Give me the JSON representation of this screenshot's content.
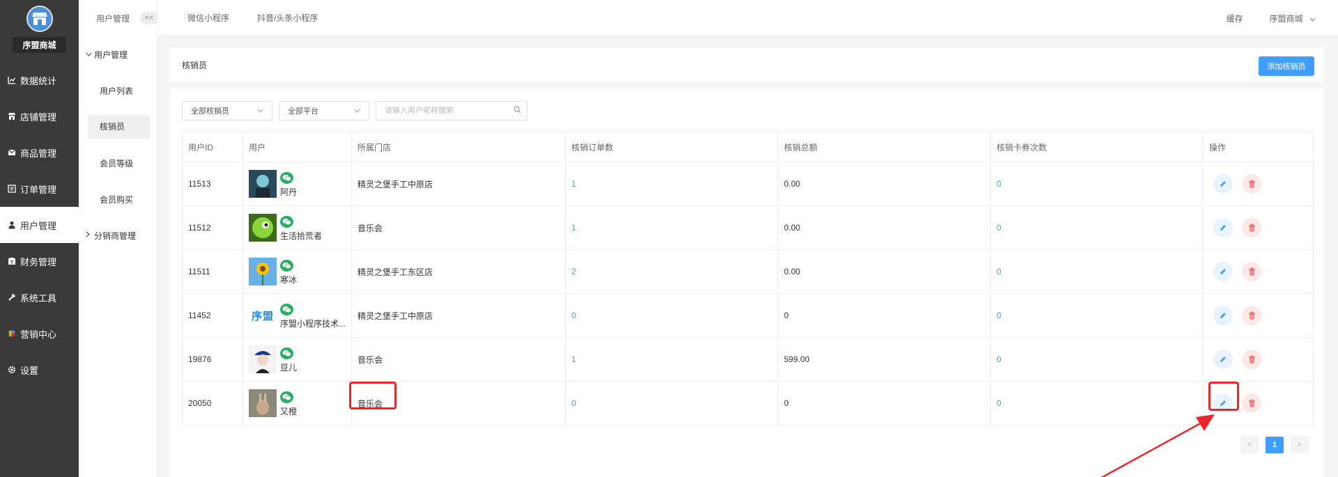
{
  "brand": {
    "name": "序盟商城"
  },
  "sidebar": {
    "items": [
      {
        "label": "数据统计",
        "icon": "chart-line-icon"
      },
      {
        "label": "店铺管理",
        "icon": "store-icon"
      },
      {
        "label": "商品管理",
        "icon": "mail-icon"
      },
      {
        "label": "订单管理",
        "icon": "list-icon"
      },
      {
        "label": "用户管理",
        "icon": "user-icon",
        "active": true
      },
      {
        "label": "财务管理",
        "icon": "wallet-icon"
      },
      {
        "label": "系统工具",
        "icon": "wrench-icon"
      },
      {
        "label": "营销中心",
        "icon": "marketing-icon"
      },
      {
        "label": "设置",
        "icon": "gear-icon"
      }
    ]
  },
  "submenu": {
    "header": "用户管理",
    "collapse_label": "<<",
    "group_open": "用户管理",
    "items": [
      "用户列表",
      "核销员",
      "会员等级",
      "会员购买"
    ],
    "group_closed": "分销商管理"
  },
  "topbar": {
    "tabs": [
      "微信小程序",
      "抖音/头条小程序"
    ],
    "cache": "缓存",
    "shop": "序盟商城"
  },
  "header": {
    "title": "核销员",
    "add_button": "添加核销员"
  },
  "filters": {
    "verifier_select": "全部核销员",
    "platform_select": "全部平台",
    "search_placeholder": "请输入用户昵称搜索"
  },
  "table": {
    "columns": [
      "用户ID",
      "用户",
      "所属门店",
      "核销订单数",
      "核销总额",
      "核销卡券次数",
      "操作"
    ],
    "rows": [
      {
        "id": "11513",
        "user": "阿丹",
        "store": "精灵之堡手工中原店",
        "orders": "1",
        "total": "0.00",
        "coupons": "0"
      },
      {
        "id": "11512",
        "user": "生活拾荒者",
        "store": "音乐会",
        "orders": "1",
        "total": "0.00",
        "coupons": "0"
      },
      {
        "id": "11511",
        "user": "寒冰",
        "store": "精灵之堡手工东区店",
        "orders": "2",
        "total": "0.00",
        "coupons": "0"
      },
      {
        "id": "11452",
        "user": "序盟小程序技术...",
        "store": "精灵之堡手工中原店",
        "orders": "0",
        "total": "0",
        "coupons": "0",
        "avatar_text": "序盟"
      },
      {
        "id": "19876",
        "user": "豆儿",
        "store": "音乐会",
        "orders": "1",
        "total": "599.00",
        "coupons": "0"
      },
      {
        "id": "20050",
        "user": "又橙",
        "store": "音乐会",
        "orders": "0",
        "total": "0",
        "coupons": "0"
      }
    ]
  },
  "pagination": {
    "prev": "<",
    "current": "1",
    "next": ">"
  },
  "colors": {
    "primary": "#409eff",
    "sidebar": "#3a3a3a",
    "highlight": "#e8262b",
    "wechat": "#2aae67"
  }
}
